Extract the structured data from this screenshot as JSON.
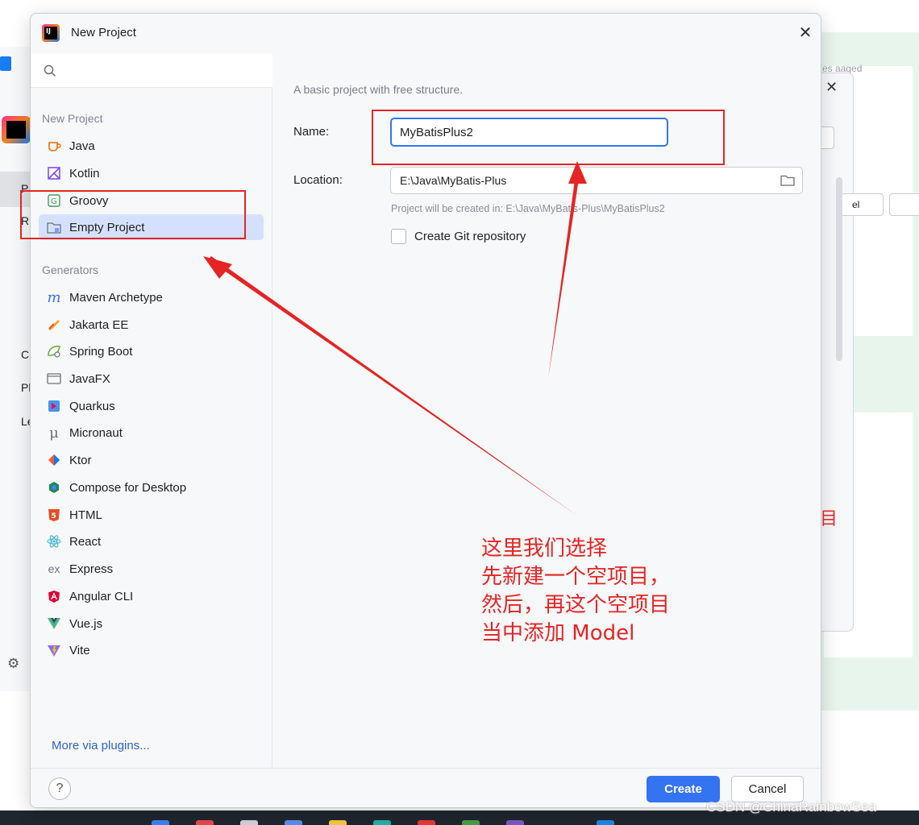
{
  "background": {
    "right_faded_text": "es aaged",
    "right_button_fragment": "el",
    "right_red_char": "目",
    "left_fragments": [
      "P",
      "R",
      "C",
      "Pl",
      "Le"
    ]
  },
  "dialog": {
    "title": "New Project",
    "search": {
      "placeholder": ""
    },
    "sections": {
      "new_project": "New Project",
      "generators": "Generators"
    },
    "project_types": [
      {
        "label": "Java",
        "icon": "java-cup-icon"
      },
      {
        "label": "Kotlin",
        "icon": "kotlin-icon"
      },
      {
        "label": "Groovy",
        "icon": "groovy-icon"
      },
      {
        "label": "Empty Project",
        "icon": "folder-icon",
        "selected": true
      }
    ],
    "generators": [
      {
        "label": "Maven Archetype",
        "icon": "maven-icon"
      },
      {
        "label": "Jakarta EE",
        "icon": "jakarta-icon"
      },
      {
        "label": "Spring Boot",
        "icon": "spring-boot-icon"
      },
      {
        "label": "JavaFX",
        "icon": "javafx-icon"
      },
      {
        "label": "Quarkus",
        "icon": "quarkus-icon"
      },
      {
        "label": "Micronaut",
        "icon": "micronaut-icon"
      },
      {
        "label": "Ktor",
        "icon": "ktor-icon"
      },
      {
        "label": "Compose for Desktop",
        "icon": "compose-icon"
      },
      {
        "label": "HTML",
        "icon": "html5-icon"
      },
      {
        "label": "React",
        "icon": "react-icon"
      },
      {
        "label": "Express",
        "icon": "express-icon"
      },
      {
        "label": "Angular CLI",
        "icon": "angular-icon"
      },
      {
        "label": "Vue.js",
        "icon": "vue-icon"
      },
      {
        "label": "Vite",
        "icon": "vite-icon"
      }
    ],
    "more_plugins": "More via plugins...",
    "form": {
      "description": "A basic project with free structure.",
      "name_label": "Name:",
      "name_value": "MyBatisPlus2",
      "location_label": "Location:",
      "location_value": "E:\\Java\\MyBatis-Plus",
      "created_in_hint": "Project will be created in: E:\\Java\\MyBatis-Plus\\MyBatisPlus2",
      "git_checkbox_label": "Create Git repository",
      "git_checked": false
    },
    "footer": {
      "help": "?",
      "create": "Create",
      "cancel": "Cancel"
    }
  },
  "annotation": {
    "lines": [
      "这里我们选择",
      "先新建一个空项目，",
      "然后，再这个空项目",
      "当中添加 Model"
    ],
    "color": "#e62424"
  },
  "watermark": "CSDN @ChinaRainbowSea",
  "colors": {
    "accent": "#3574f0",
    "selection": "#d5e1fc",
    "annotation_red": "#e62424"
  }
}
